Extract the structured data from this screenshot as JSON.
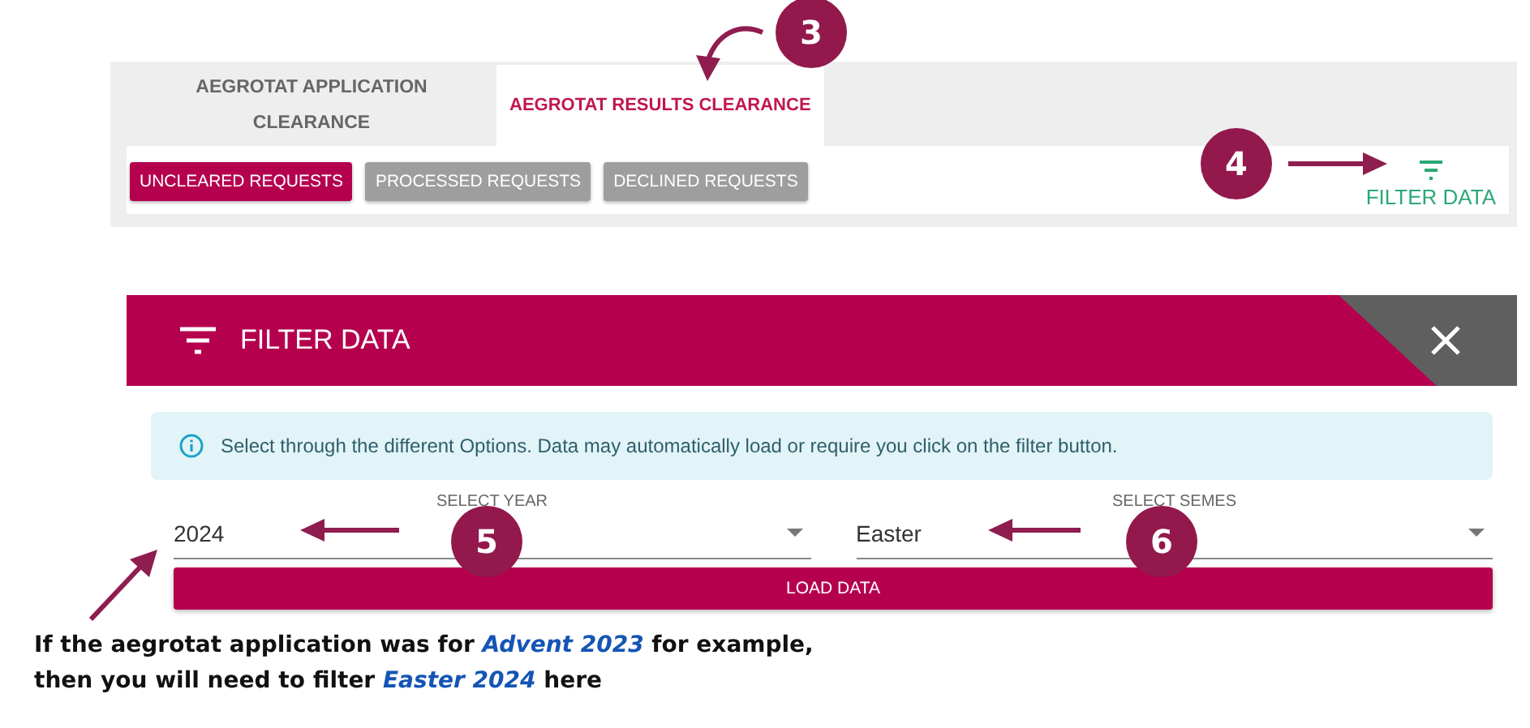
{
  "tabs": [
    {
      "label": "AEGROTAT APPLICATION CLEARANCE",
      "selected": false
    },
    {
      "label": "AEGROTAT RESULTS CLEARANCE",
      "selected": true
    }
  ],
  "request_buttons": [
    {
      "label": "UNCLEARED REQUESTS",
      "selected": true
    },
    {
      "label": "PROCESSED REQUESTS",
      "selected": false
    },
    {
      "label": "DECLINED REQUESTS",
      "selected": false
    }
  ],
  "filter_button": {
    "label": "FILTER DATA"
  },
  "filter_panel": {
    "title": "FILTER DATA",
    "info": "Select through the different Options. Data may automatically load or require you click on the filter button.",
    "fields": [
      {
        "label": "SELECT YEAR",
        "value": "2024"
      },
      {
        "label": "SELECT SEMES",
        "value": "Easter"
      }
    ],
    "load_button": "LOAD DATA"
  },
  "step_badges": [
    "3",
    "4",
    "5",
    "6"
  ],
  "note": "If the aegrotat application was for *Advent 2023* for example, then you will need to filter *Easter 2024* here"
}
